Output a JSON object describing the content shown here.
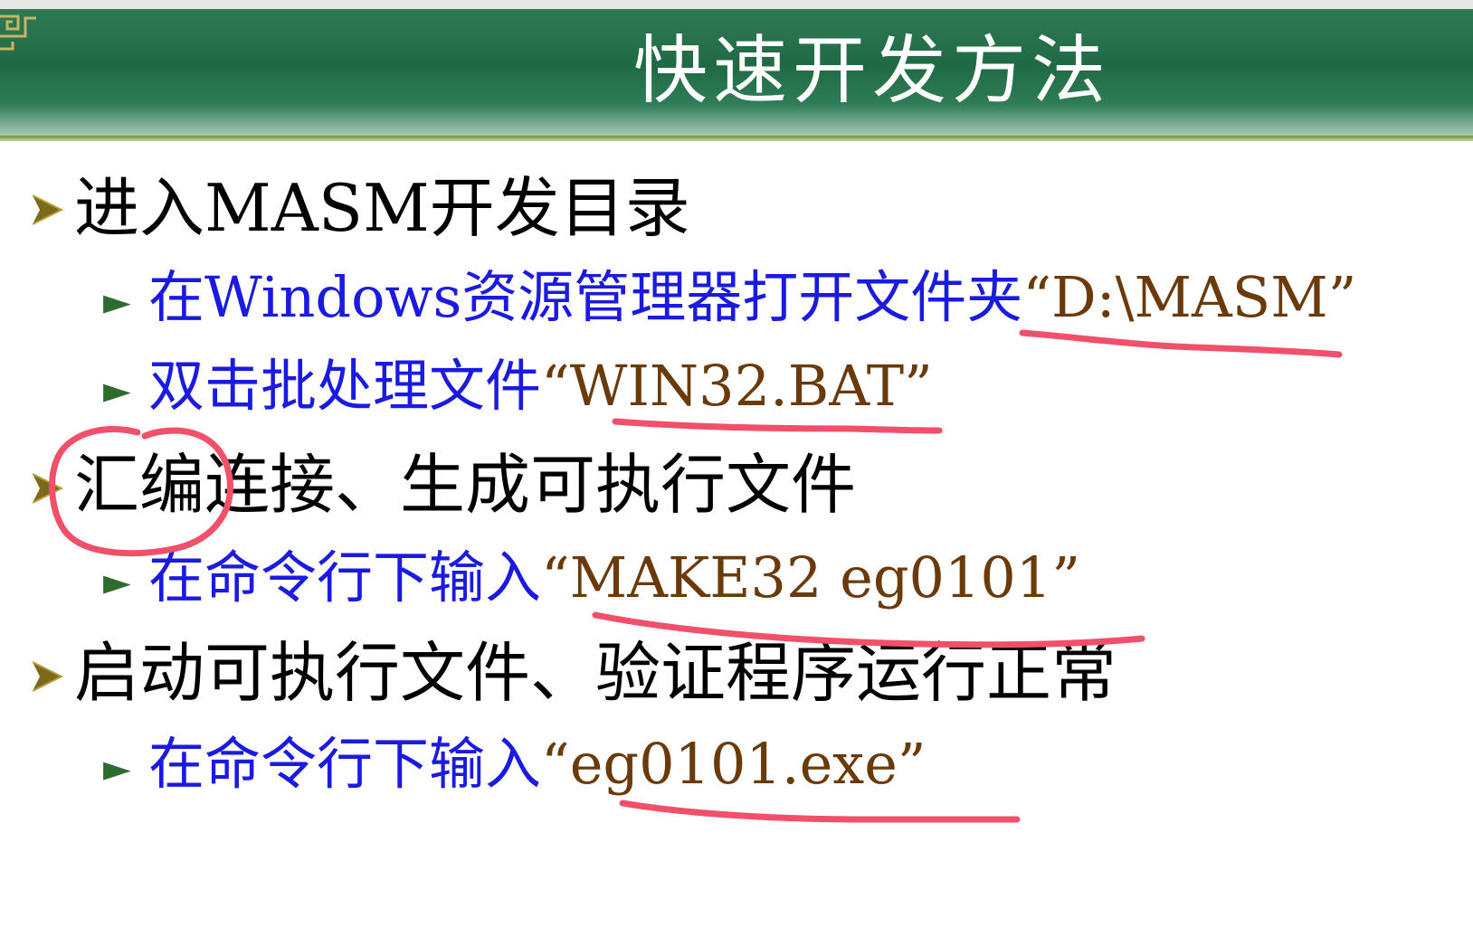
{
  "title": "快速开发方法",
  "items": [
    {
      "text": "进入MASM开发目录",
      "subitems": [
        {
          "text": "在Windows资源管理器打开文件夹",
          "code": "“D:\\MASM”"
        },
        {
          "text": "双击批处理文件",
          "code": "“WIN32.BAT”"
        }
      ]
    },
    {
      "text": "汇编连接、生成可执行文件",
      "subitems": [
        {
          "text": "在命令行下输入",
          "code": "“MAKE32 eg0101”"
        }
      ]
    },
    {
      "text": "启动可执行文件、验证程序运行正常",
      "subitems": [
        {
          "text": "在命令行下输入",
          "code": "“eg0101.exe”"
        }
      ]
    }
  ],
  "colors": {
    "header_green": "#1f6a45",
    "level1_text": "#000000",
    "level2_text": "#1a1ae0",
    "code_text": "#6b3a0b",
    "annotation_red": "#f0506a"
  }
}
